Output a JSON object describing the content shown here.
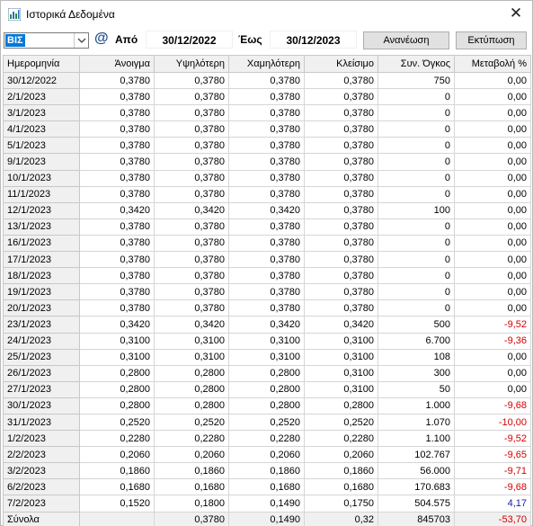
{
  "window": {
    "title": "Ιστορικά Δεδομένα",
    "close_glyph": "✕"
  },
  "toolbar": {
    "symbol": "ΒΙΣ",
    "at_glyph": "@",
    "from_label": "Από",
    "from_date": "30/12/2022",
    "to_label": "Έως",
    "to_date": "30/12/2023",
    "refresh_label": "Ανανέωση",
    "print_label": "Εκτύπωση"
  },
  "table": {
    "headers": [
      "Ημερομηνία",
      "Άνοιγμα",
      "Υψηλότερη",
      "Χαμηλότερη",
      "Κλείσιμο",
      "Συν. Όγκος",
      "Μεταβολή %"
    ],
    "rows": [
      [
        "30/12/2022",
        "0,3780",
        "0,3780",
        "0,3780",
        "0,3780",
        "750",
        "0,00"
      ],
      [
        "2/1/2023",
        "0,3780",
        "0,3780",
        "0,3780",
        "0,3780",
        "0",
        "0,00"
      ],
      [
        "3/1/2023",
        "0,3780",
        "0,3780",
        "0,3780",
        "0,3780",
        "0",
        "0,00"
      ],
      [
        "4/1/2023",
        "0,3780",
        "0,3780",
        "0,3780",
        "0,3780",
        "0",
        "0,00"
      ],
      [
        "5/1/2023",
        "0,3780",
        "0,3780",
        "0,3780",
        "0,3780",
        "0",
        "0,00"
      ],
      [
        "9/1/2023",
        "0,3780",
        "0,3780",
        "0,3780",
        "0,3780",
        "0",
        "0,00"
      ],
      [
        "10/1/2023",
        "0,3780",
        "0,3780",
        "0,3780",
        "0,3780",
        "0",
        "0,00"
      ],
      [
        "11/1/2023",
        "0,3780",
        "0,3780",
        "0,3780",
        "0,3780",
        "0",
        "0,00"
      ],
      [
        "12/1/2023",
        "0,3420",
        "0,3420",
        "0,3420",
        "0,3780",
        "100",
        "0,00"
      ],
      [
        "13/1/2023",
        "0,3780",
        "0,3780",
        "0,3780",
        "0,3780",
        "0",
        "0,00"
      ],
      [
        "16/1/2023",
        "0,3780",
        "0,3780",
        "0,3780",
        "0,3780",
        "0",
        "0,00"
      ],
      [
        "17/1/2023",
        "0,3780",
        "0,3780",
        "0,3780",
        "0,3780",
        "0",
        "0,00"
      ],
      [
        "18/1/2023",
        "0,3780",
        "0,3780",
        "0,3780",
        "0,3780",
        "0",
        "0,00"
      ],
      [
        "19/1/2023",
        "0,3780",
        "0,3780",
        "0,3780",
        "0,3780",
        "0",
        "0,00"
      ],
      [
        "20/1/2023",
        "0,3780",
        "0,3780",
        "0,3780",
        "0,3780",
        "0",
        "0,00"
      ],
      [
        "23/1/2023",
        "0,3420",
        "0,3420",
        "0,3420",
        "0,3420",
        "500",
        "-9,52"
      ],
      [
        "24/1/2023",
        "0,3100",
        "0,3100",
        "0,3100",
        "0,3100",
        "6.700",
        "-9,36"
      ],
      [
        "25/1/2023",
        "0,3100",
        "0,3100",
        "0,3100",
        "0,3100",
        "108",
        "0,00"
      ],
      [
        "26/1/2023",
        "0,2800",
        "0,2800",
        "0,2800",
        "0,3100",
        "300",
        "0,00"
      ],
      [
        "27/1/2023",
        "0,2800",
        "0,2800",
        "0,2800",
        "0,3100",
        "50",
        "0,00"
      ],
      [
        "30/1/2023",
        "0,2800",
        "0,2800",
        "0,2800",
        "0,2800",
        "1.000",
        "-9,68"
      ],
      [
        "31/1/2023",
        "0,2520",
        "0,2520",
        "0,2520",
        "0,2520",
        "1.070",
        "-10,00"
      ],
      [
        "1/2/2023",
        "0,2280",
        "0,2280",
        "0,2280",
        "0,2280",
        "1.100",
        "-9,52"
      ],
      [
        "2/2/2023",
        "0,2060",
        "0,2060",
        "0,2060",
        "0,2060",
        "102.767",
        "-9,65"
      ],
      [
        "3/2/2023",
        "0,1860",
        "0,1860",
        "0,1860",
        "0,1860",
        "56.000",
        "-9,71"
      ],
      [
        "6/2/2023",
        "0,1680",
        "0,1680",
        "0,1680",
        "0,1680",
        "170.683",
        "-9,68"
      ],
      [
        "7/2/2023",
        "0,1520",
        "0,1800",
        "0,1490",
        "0,1750",
        "504.575",
        "4,17"
      ]
    ],
    "totals": [
      "Σύνολα",
      "",
      "0,3780",
      "0,1490",
      "0,32",
      "845703",
      "-53,70"
    ]
  },
  "colors": {
    "negative": "#d40000",
    "positive": "#1a1aa8",
    "selection": "#0078d7"
  }
}
